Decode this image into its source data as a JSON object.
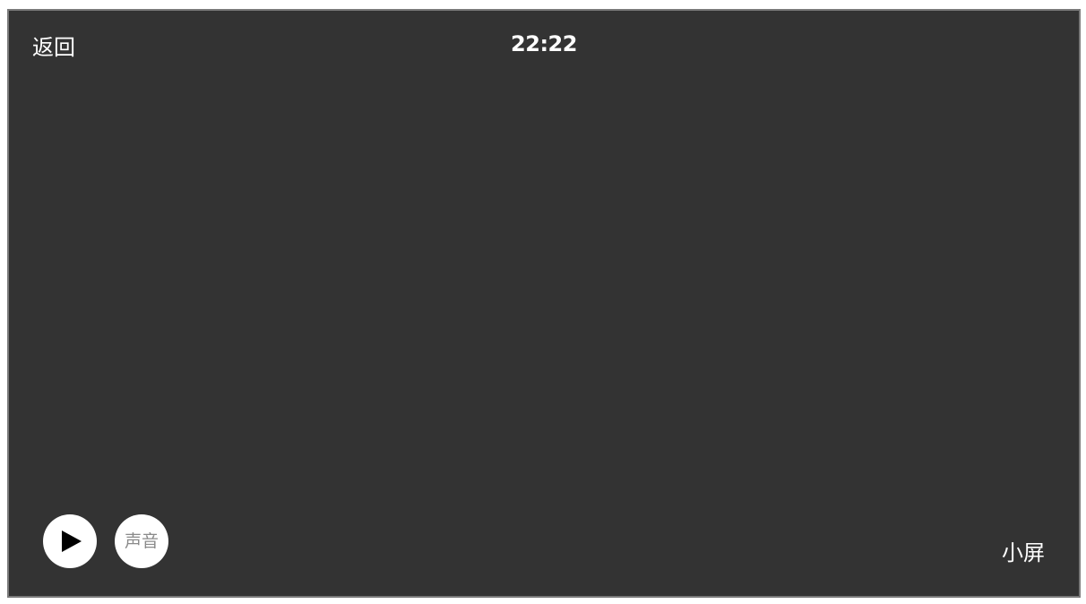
{
  "header": {
    "back_label": "返回",
    "time": "22:22"
  },
  "controls": {
    "play_icon": "play-icon",
    "sound_label": "声音",
    "small_screen_label": "小屏"
  },
  "colors": {
    "player_background": "#333333",
    "player_border": "#7a7a7a",
    "button_background": "#ffffff",
    "text": "#ffffff",
    "sound_label": "#8a8a8a"
  }
}
